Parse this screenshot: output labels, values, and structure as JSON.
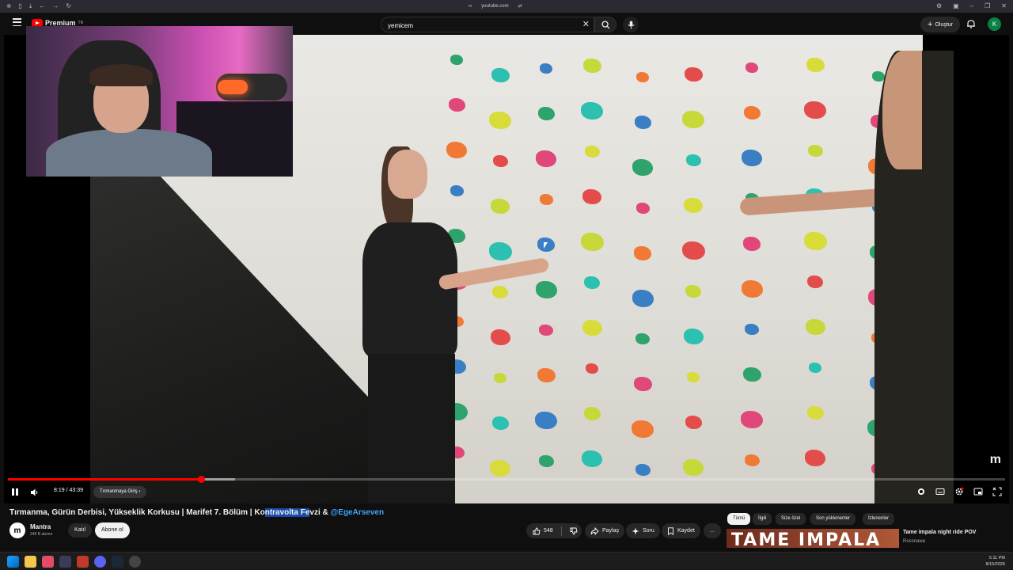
{
  "browser": {
    "url": "youtube.com"
  },
  "header": {
    "logo_text": "Premium",
    "logo_sup": "TR",
    "search_value": "yemicem",
    "create_label": "Oluştur",
    "avatar_letter": "K"
  },
  "player": {
    "time": "8:19 / 43:39",
    "chapter": "Tırmanmaya Giriş",
    "progress": {
      "played_fraction": 0.194,
      "loaded_fraction": 0.228
    },
    "watermark": "m"
  },
  "video": {
    "title_parts": [
      "Tırmanma, Gürün Derbisi, Yükseklik Korkusu | Marifet 7. Bölüm | Ko",
      "ntravolta Fe",
      "vzi & ",
      "@EgeArseven"
    ],
    "channel": {
      "name": "Mantra",
      "subs": "248 B abone",
      "avatar_letter": "m"
    },
    "join_label": "Katıl",
    "subscribe_label": "Abone ol",
    "likes": "548",
    "share_label": "Paylaş",
    "ask_label": "Soru",
    "save_label": "Kaydet",
    "more_label": "..."
  },
  "chips": [
    "Tümü",
    "İlgili",
    "Size özel",
    "Son yüklenenler",
    "İzlenenler"
  ],
  "recommendation": {
    "thumb_text": "TAME IMPALA",
    "title": "Tame impala night ride POV",
    "channel": "Rossnawa"
  },
  "taskbar": {
    "time": "5:11 PM",
    "date": "8/15/2026"
  },
  "colors": {
    "accent_red": "#ff0000",
    "link_blue": "#3ea6ff",
    "background": "#0f0f0f"
  }
}
